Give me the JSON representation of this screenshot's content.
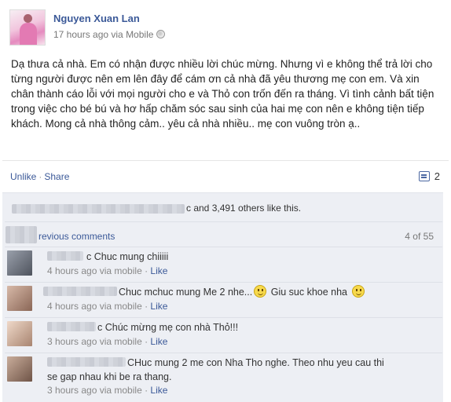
{
  "post": {
    "author": "Nguyen Xuan Lan",
    "time": "17 hours ago via Mobile",
    "paragraph": "Dạ thưa cả nhà. Em có nhận được nhiều lời chúc mừng. Nhưng vì e không thể trả lời cho từng người được nên em lên đây để cám ơn cả nhà đã yêu thương mẹ con em. Và xin chân thành cáo lỗi với mọi người cho e và Thỏ con trốn đến ra tháng. Vì tình cảnh bất tiện trong việc cho bé bú và hơ hấp chăm sóc sau sinh của hai mẹ con nên e không tiện tiếp khách. Mong cả nhà thông cảm.. yêu cả nhà nhiều.. mẹ con vuông tròn ạ.."
  },
  "actions": {
    "unlike": "Unlike",
    "separator": "·",
    "share": "Share",
    "comment_count": "2"
  },
  "likes": {
    "tail_char": "c",
    "text": " and 3,491 others like this."
  },
  "previous": {
    "link": "revious comments",
    "count": "4 of 55"
  },
  "comments": [
    {
      "name_tail": "c",
      "text": "Chuc mung chiiiii",
      "time": "4 hours ago via mobile",
      "like": "Like",
      "avatar_color": "#6a6f7a"
    },
    {
      "name_tail": "",
      "text": "Chuc mchuc mung Me 2 nhe...",
      "text_after": "Giu suc khoe nha",
      "time": "4 hours ago via mobile",
      "like": "Like",
      "avatar_color": "#b08a78"
    },
    {
      "name_tail": "c",
      "text": "Chúc mừng mẹ con nhà Thỏ!!!",
      "time": "3 hours ago via mobile",
      "like": "Like",
      "avatar_color": "#c7a48f"
    },
    {
      "name_tail": "",
      "text": "CHuc mung 2 me con Nha Tho nghe. Theo nhu yeu cau thi se gap nhau khi be ra thang.",
      "time": "3 hours ago via mobile",
      "like": "Like",
      "avatar_color": "#9a7c6c"
    }
  ]
}
